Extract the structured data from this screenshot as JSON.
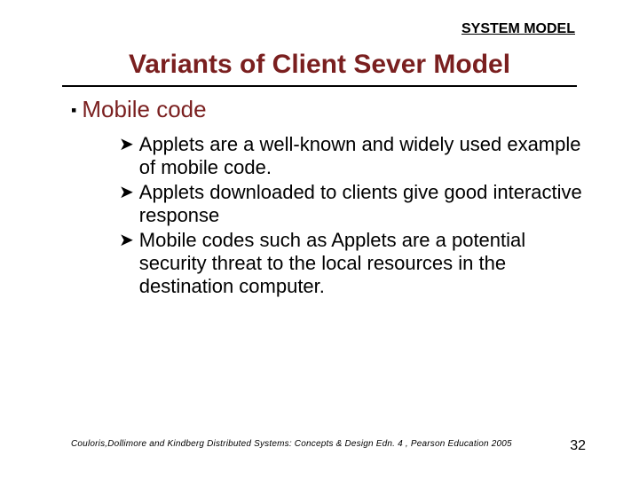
{
  "header": {
    "label": "SYSTEM MODEL"
  },
  "title": "Variants of Client Sever Model",
  "section": {
    "heading": "Mobile code",
    "bullets": [
      "Applets are a well-known and widely used example of mobile code.",
      "Applets downloaded to clients give good interactive response",
      "Mobile codes such as Applets are a potential security threat to the local resources in the destination computer."
    ]
  },
  "footer": {
    "reference": "Couloris,Dollimore and Kindberg  Distributed Systems: Concepts & Design  Edn. 4 , Pearson Education 2005",
    "page": "32"
  }
}
